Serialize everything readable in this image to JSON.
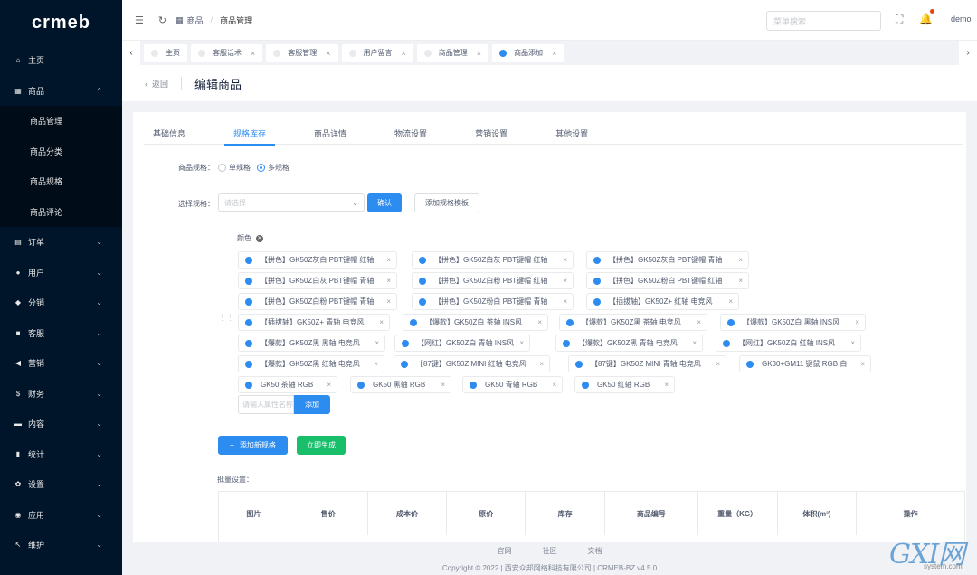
{
  "brand": {
    "logo_text": "crmeb"
  },
  "sidebar": {
    "items": [
      {
        "label": "主页",
        "icon": "home-icon",
        "glyph": "⌂",
        "arrow": ""
      },
      {
        "label": "商品",
        "icon": "shop-icon",
        "glyph": "▦",
        "arrow": "⌃"
      },
      {
        "label": "订单",
        "icon": "cart-icon",
        "glyph": "▤",
        "arrow": "⌄"
      },
      {
        "label": "用户",
        "icon": "user-icon",
        "glyph": "●",
        "arrow": "⌄"
      },
      {
        "label": "分销",
        "icon": "share-icon",
        "glyph": "◆",
        "arrow": "⌄"
      },
      {
        "label": "客服",
        "icon": "chat-icon",
        "glyph": "■",
        "arrow": "⌄"
      },
      {
        "label": "营销",
        "icon": "send-icon",
        "glyph": "◀",
        "arrow": "⌄"
      },
      {
        "label": "财务",
        "icon": "dollar-icon",
        "glyph": "$",
        "arrow": "⌄"
      },
      {
        "label": "内容",
        "icon": "doc-icon",
        "glyph": "▬",
        "arrow": "⌄"
      },
      {
        "label": "统计",
        "icon": "chart-icon",
        "glyph": "▮",
        "arrow": "⌄"
      },
      {
        "label": "设置",
        "icon": "gear-icon",
        "glyph": "✿",
        "arrow": "⌄"
      },
      {
        "label": "应用",
        "icon": "app-icon",
        "glyph": "◉",
        "arrow": "⌄"
      },
      {
        "label": "维护",
        "icon": "tool-icon",
        "glyph": "↖",
        "arrow": "⌄"
      }
    ],
    "submenu": [
      "商品管理",
      "商品分类",
      "商品规格",
      "商品评论"
    ]
  },
  "header": {
    "breadcrumb_root": "商品",
    "breadcrumb_current": "商品管理",
    "search_placeholder": "菜单搜索",
    "user": "demo"
  },
  "tabs": [
    {
      "label": "主页",
      "active": false
    },
    {
      "label": "客服话术",
      "active": false
    },
    {
      "label": "客服管理",
      "active": false
    },
    {
      "label": "用户留言",
      "active": false
    },
    {
      "label": "商品管理",
      "active": false
    },
    {
      "label": "商品添加",
      "active": true
    }
  ],
  "page": {
    "back": "返回",
    "title": "编辑商品"
  },
  "form_tabs": [
    "基础信息",
    "规格库存",
    "商品详情",
    "物流设置",
    "营销设置",
    "其他设置"
  ],
  "form": {
    "spec_label": "商品规格：",
    "single": "单规格",
    "multi": "多规格",
    "select_label": "选择规格：",
    "select_placeholder": "请选择",
    "confirm": "确认",
    "add_template": "添加规格模板",
    "attr_name": "颜色",
    "attr_input_placeholder": "请输入属性名称",
    "add": "添加",
    "add_spec": "添加新规格",
    "generate": "立即生成",
    "batch_label": "批量设置："
  },
  "chips": [
    "【拼色】GK50Z灰白 PBT键帽 红轴",
    "【拼色】GK50Z白灰 PBT键帽 红轴",
    "【拼色】GK50Z灰白 PBT键帽 青轴",
    "【拼色】GK50Z白灰 PBT键帽 青轴",
    "【拼色】GK50Z白粉 PBT键帽 红轴",
    "【拼色】GK50Z粉白 PBT键帽 红轴",
    "【拼色】GK50Z白粉 PBT键帽 青轴",
    "【拼色】GK50Z粉白 PBT键帽 青轴",
    "【插拔轴】GK50Z+ 红轴 电竞风",
    "【插拔轴】GK50Z+ 青轴 电竞风",
    "【爆款】GK50Z白 茶轴 INS风",
    "【爆款】GK50Z黑 茶轴 电竞风",
    "【爆款】GK50Z白 黑轴 INS风",
    "【爆款】GK50Z黑 黑轴 电竞风",
    "【网红】GK50Z白 青轴 INS风",
    "【爆款】GK50Z黑 青轴 电竞风",
    "【网红】GK50Z白 红轴 INS风",
    "【爆款】GK50Z黑 红轴 电竞风",
    "【87键】GK50Z MINI 红轴 电竞风",
    "【87键】GK50Z MINI 青轴 电竞风",
    "GK30+GM11 键鼠 RGB 白",
    "GK50 茶轴 RGB",
    "GK50 黑轴 RGB",
    "GK50 青轴 RGB",
    "GK50 红轴 RGB"
  ],
  "table_headers": [
    "图片",
    "售价",
    "成本价",
    "原价",
    "库存",
    "商品编号",
    "重量（KG）",
    "体积(m³)",
    "操作"
  ],
  "footer": {
    "links": [
      "官网",
      "社区",
      "文档"
    ],
    "copyright": "Copyright © 2022 | 西安众邦网络科技有限公司 | CRMEB-BZ v4.5.0"
  },
  "watermark": {
    "main": "GXI网",
    "sub": "system.com"
  },
  "colors": {
    "primary": "#2d8cf0",
    "success": "#19be6b",
    "sidebar": "#001529"
  }
}
